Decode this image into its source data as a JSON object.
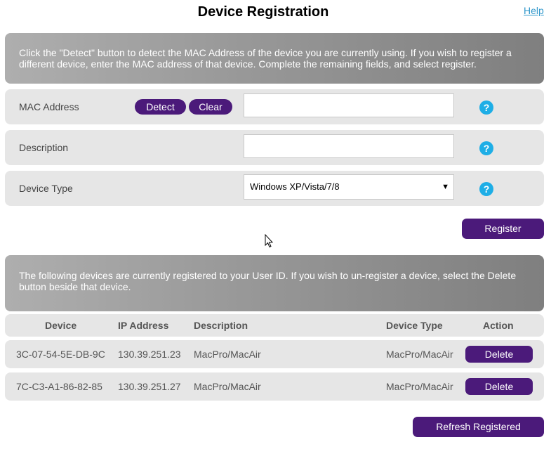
{
  "header": {
    "title": "Device Registration",
    "help_link": "Help"
  },
  "registration": {
    "instructions": "Click the \"Detect\" button to detect the MAC Address of the device you are currently using. If you wish to register a different device, enter the MAC address of that device. Complete the remaining fields, and select register.",
    "mac_label": "MAC Address",
    "detect_label": "Detect",
    "clear_label": "Clear",
    "mac_value": "",
    "description_label": "Description",
    "description_value": "",
    "device_type_label": "Device Type",
    "device_type_selected": "Windows XP/Vista/7/8",
    "help_glyph": "?",
    "register_label": "Register"
  },
  "registered": {
    "instructions": "The following devices are currently registered to your User ID.  If you wish to un-register a device, select the Delete button beside that device.",
    "columns": [
      "Device",
      "IP Address",
      "Description",
      "Device Type",
      "Action"
    ],
    "rows": [
      {
        "device": "3C-07-54-5E-DB-9C",
        "ip": "130.39.251.23",
        "description": "MacPro/MacAir",
        "type": "MacPro/MacAir",
        "action": "Delete"
      },
      {
        "device": "7C-C3-A1-86-82-85",
        "ip": "130.39.251.27",
        "description": "MacPro/MacAir",
        "type": "MacPro/MacAir",
        "action": "Delete"
      }
    ],
    "refresh_label": "Refresh Registered"
  },
  "icons": {
    "help": "question-circle-icon",
    "dropdown": "caret-down-icon",
    "cursor": "mouse-pointer-icon"
  },
  "colors": {
    "accent": "#4b1a7a",
    "help_icon": "#1eaee6",
    "row_bg": "#e6e6e6",
    "link": "#3399cc"
  }
}
